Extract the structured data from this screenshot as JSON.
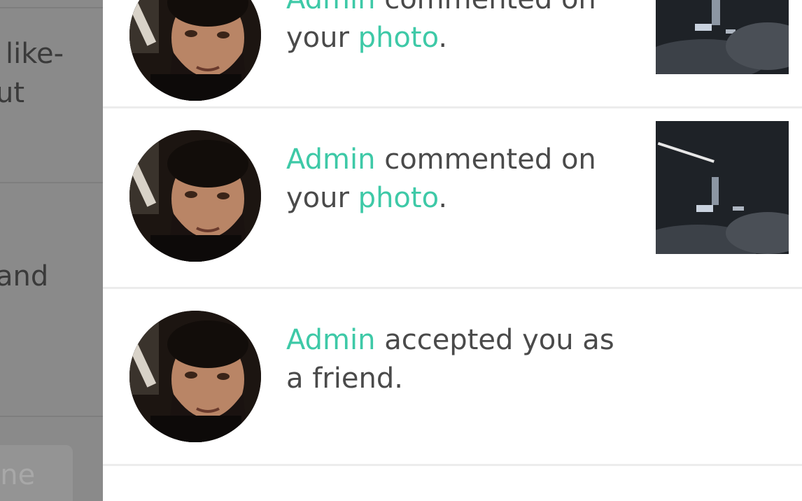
{
  "background_page": {
    "text_lines": [
      "like-",
      "ut",
      "and"
    ],
    "button_label": "line"
  },
  "notifications": [
    {
      "actor": "Admin",
      "action_lead": "commented on",
      "action_tail": "your",
      "object": "photo",
      "end": ".",
      "has_thumbnail": true
    },
    {
      "actor": "Admin",
      "action_lead": "commented on",
      "action_tail": "your",
      "object": "photo",
      "end": ".",
      "has_thumbnail": true
    },
    {
      "actor": "Admin",
      "action_lead": "accepted you as",
      "action_tail": "a friend.",
      "object": "",
      "end": "",
      "has_thumbnail": false
    }
  ],
  "colors": {
    "accent": "#3ec9a7",
    "text": "#4a4a4a",
    "overlay": "#8a8a8a"
  },
  "icons": {
    "avatar": "user-avatar",
    "thumbnail": "photo-thumbnail"
  }
}
